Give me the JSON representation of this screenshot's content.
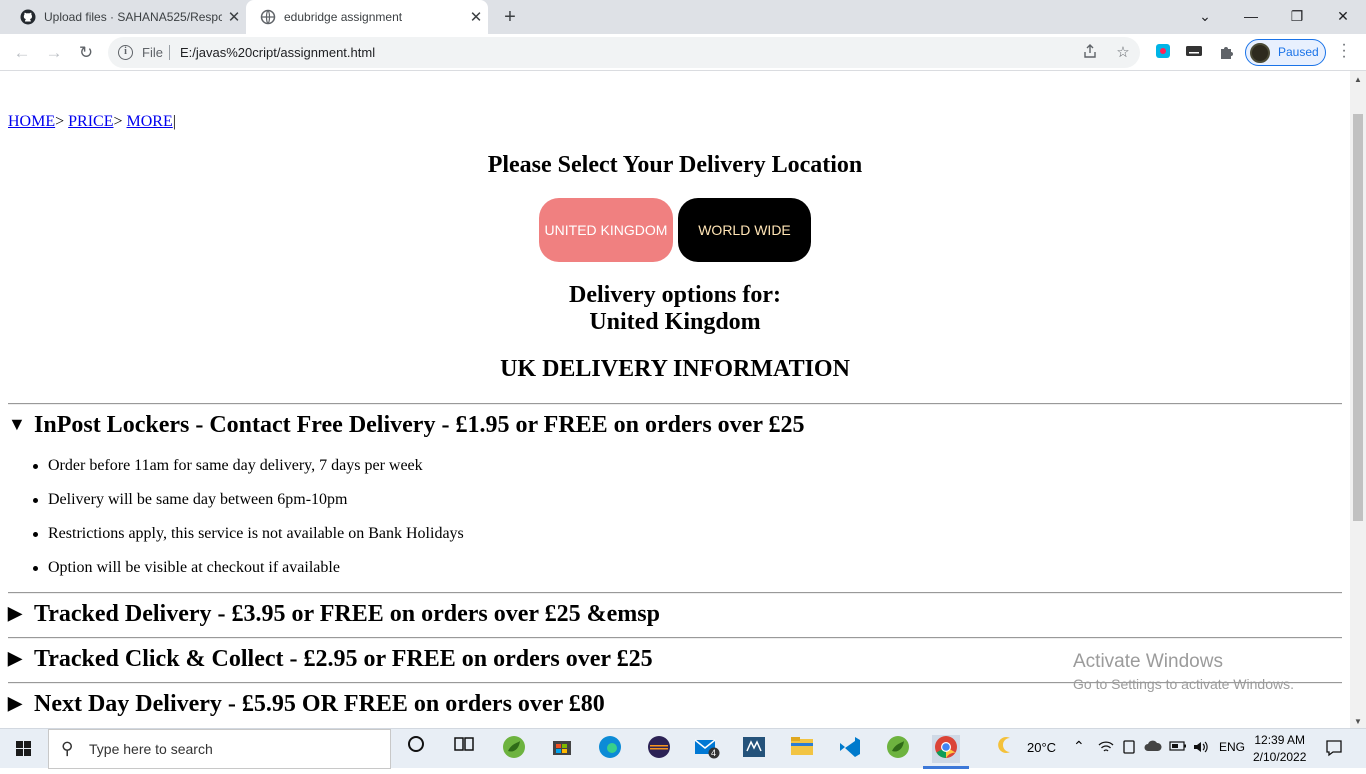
{
  "browser": {
    "tabs": [
      {
        "title": "Upload files · SAHANA525/Respc",
        "close": "✕"
      },
      {
        "title": "edubridge assignment",
        "close": "✕"
      }
    ],
    "new_tab": "+",
    "window_controls": {
      "minimize": "—",
      "maximize": "❐",
      "close": "✕",
      "tab_search": "⌄"
    },
    "omnibox": {
      "scheme_label": "File",
      "url": "E:/javas%20cript/assignment.html"
    },
    "profile_status": "Paused"
  },
  "page": {
    "breadcrumb": {
      "home": "HOME",
      "sep1": ">",
      "price": "PRICE",
      "sep2": ">",
      "more": "MORE",
      "tail": "|"
    },
    "select_heading": "Please Select Your Delivery Location",
    "buttons": {
      "uk": "UNITED KINGDOM",
      "worldwide": "WORLD WIDE"
    },
    "options_line1": "Delivery options for:",
    "options_line2": "United Kingdom",
    "info_heading": "UK DELIVERY INFORMATION",
    "sections": [
      {
        "title": "InPost Lockers - Contact Free Delivery - £1.95 or FREE on orders over £25",
        "expanded": true,
        "items": [
          "Order before 11am for same day delivery, 7 days per week",
          "Delivery will be same day between 6pm-10pm",
          "Restrictions apply, this service is not available on Bank Holidays",
          "Option will be visible at checkout if available"
        ]
      },
      {
        "title": "Tracked Delivery - £3.95 or FREE on orders over £25 &emsp",
        "expanded": false
      },
      {
        "title": "Tracked Click & Collect - £2.95 or FREE on orders over £25",
        "expanded": false
      },
      {
        "title": "Next Day Delivery - £5.95 OR FREE on orders over £80",
        "expanded": false
      }
    ],
    "watermark": {
      "line1": "Activate Windows",
      "line2": "Go to Settings to activate Windows."
    }
  },
  "taskbar": {
    "search_placeholder": "Type here to search",
    "weather": "20°C",
    "language": "ENG",
    "time": "12:39 AM",
    "date": "2/10/2022",
    "mail_badge": "4"
  },
  "colors": {
    "uk_button": "#f08080",
    "worldwide_button": "#000000",
    "worldwide_text": "#ffe4b5",
    "link": "#0000ee"
  }
}
